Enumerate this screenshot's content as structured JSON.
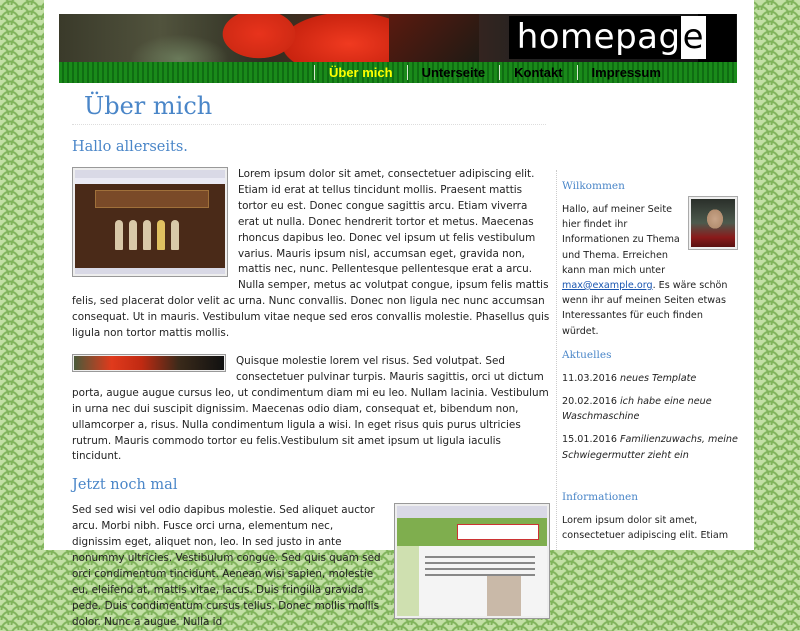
{
  "header": {
    "site_title_main": "homepag",
    "site_title_last": "e"
  },
  "nav": {
    "items": [
      {
        "label": "Über mich",
        "active": true
      },
      {
        "label": "Unterseite",
        "active": false
      },
      {
        "label": "Kontakt",
        "active": false
      },
      {
        "label": "Impressum",
        "active": false
      }
    ]
  },
  "main": {
    "page_title": "Über mich",
    "section1_heading": "Hallo allerseits.",
    "para1": "Lorem ipsum dolor sit amet, consectetuer adipiscing elit. Etiam id erat at tellus tincidunt mollis. Praesent mattis tortor eu est. Donec congue sagittis arcu. Etiam viverra erat ut nulla. Donec hendrerit tortor et metus. Maecenas rhoncus dapibus leo. Donec vel ipsum ut felis vestibulum varius. Mauris ipsum nisl, accumsan eget, gravida non, mattis nec, nunc. Pellentesque pellentesque erat a arcu. Nulla semper, metus ac volutpat congue, ipsum felis mattis felis, sed placerat dolor velit ac urna. Nunc convallis. Donec non ligula nec nunc accumsan consequat. Ut in mauris. Vestibulum vitae neque sed eros convallis molestie. Phasellus quis ligula non tortor mattis mollis.",
    "para2": "Quisque molestie lorem vel risus. Sed volutpat. Sed consectetuer pulvinar turpis. Mauris sagittis, orci ut dictum porta, augue augue cursus leo, ut condimentum diam mi eu leo. Nullam lacinia. Vestibulum in urna nec dui suscipit dignissim. Maecenas odio diam, consequat et, bibendum non, ullamcorper a, risus. Nulla condimentum ligula a wisi. In eget risus quis purus ultricies rutrum. Mauris commodo tortor eu felis.Vestibulum sit amet ipsum ut ligula iaculis tincidunt.",
    "section2_heading": "Jetzt noch mal",
    "para3": "Sed sed wisi vel odio dapibus molestie. Sed aliquet auctor arcu. Morbi nibh. Fusce orci urna, elementum nec, dignissim eget, aliquet non, leo. In sed justo in ante nonummy ultricies. Vestibulum congue. Sed quis quam sed orci condimentum tincidunt. Aenean wisi sapien, molestie eu, eleifend at, mattis vitae, lacus. Duis fringilla gravida pede. Duis condimentum cursus tellus. Donec mollis mollis dolor. Nunc a augue. Nulla id"
  },
  "sidebar": {
    "welcome_heading": "Wilkommen",
    "welcome_text_before_link": "Hallo, auf meiner Seite hier findet ihr Informationen zu Thema und Thema. Erreichen kann man mich unter ",
    "email": "max@example.org",
    "welcome_text_after_link": ". Es wäre schön wenn ihr auf meinen Seiten etwas Interessantes für euch finden würdet.",
    "news_heading": "Aktuelles",
    "news": [
      {
        "date": "11.03.2016",
        "text": "neues Template"
      },
      {
        "date": "20.02.2016",
        "text": "ich habe eine neue Waschmaschine"
      },
      {
        "date": "15.01.2016",
        "text": "Familienzuwachs, meine Schwiegermutter zieht ein"
      }
    ],
    "info_heading": "Informationen",
    "info_text": "Lorem ipsum dolor sit amet, consectetuer adipiscing elit. Etiam"
  },
  "colors": {
    "accent_blue": "#4a86c8",
    "nav_green": "#1a8a1a",
    "nav_active": "#ffff00",
    "background_green": "#c3e0a6"
  }
}
